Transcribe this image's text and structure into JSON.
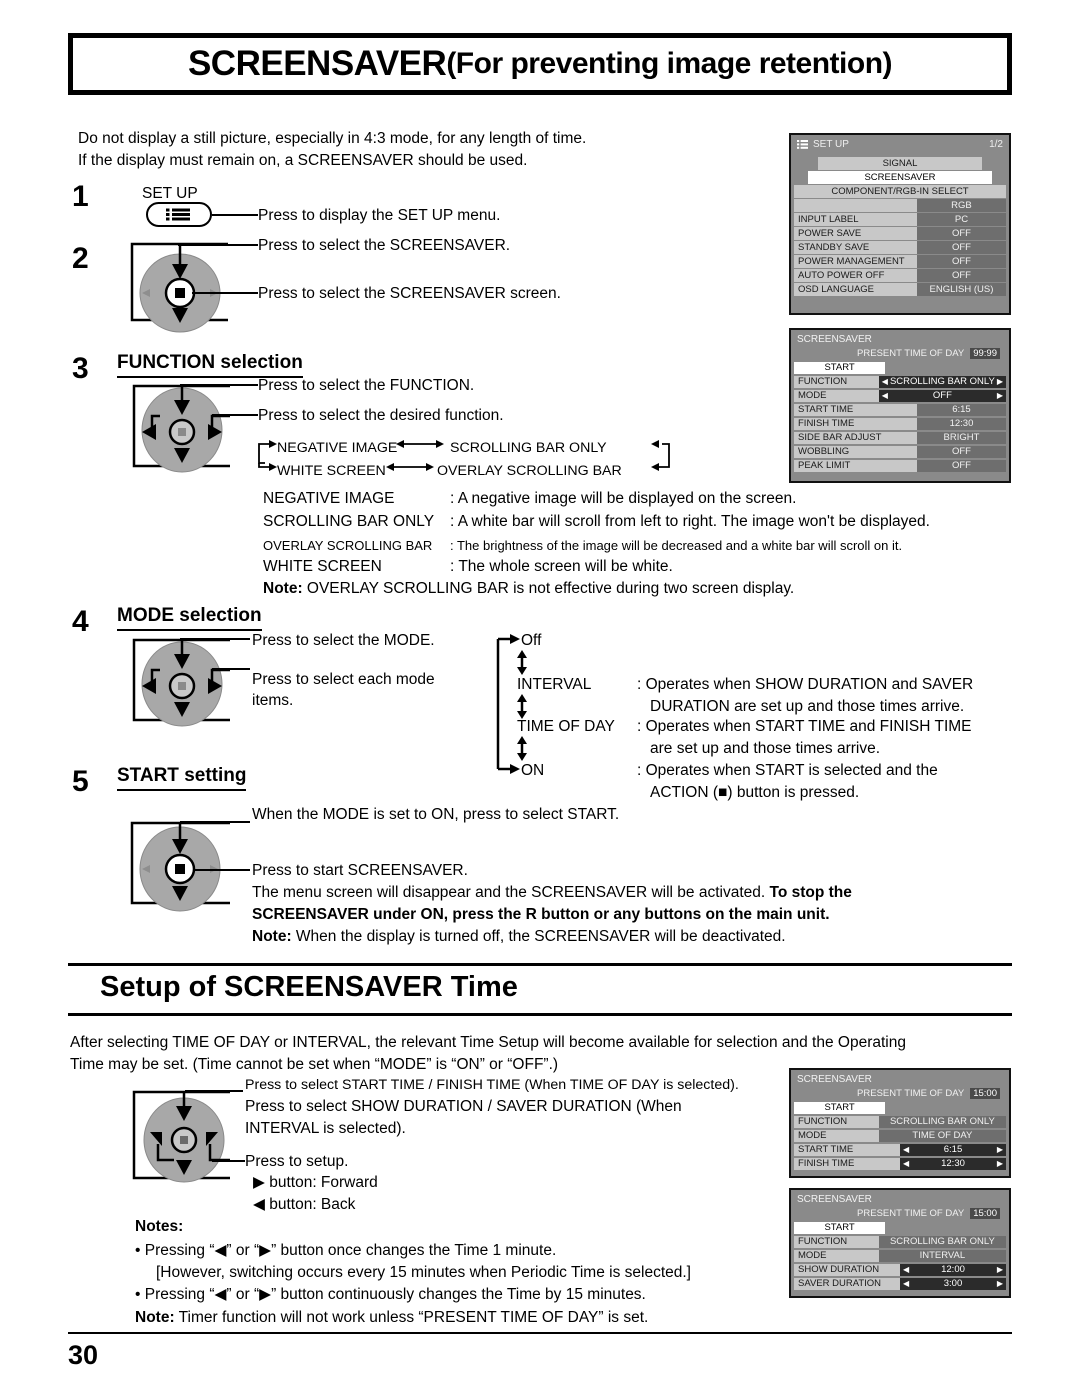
{
  "header": {
    "title_main": "SCREENSAVER",
    "title_sub": " (For preventing image retention)"
  },
  "intro": {
    "line1": "Do not display a still picture, especially in 4:3 mode, for any length of time.",
    "line2": "If the display must remain on, a SCREENSAVER should be used."
  },
  "steps": {
    "one": {
      "num": "1",
      "button_label": "SET UP",
      "instruction": "Press to display the SET UP menu."
    },
    "two": {
      "num": "2",
      "instruction_up": "Press to select the SCREENSAVER.",
      "instruction_action": "Press to select the SCREENSAVER screen."
    },
    "three": {
      "num": "3",
      "heading": "FUNCTION selection",
      "instruction_up": "Press to select the FUNCTION.",
      "instruction_lr": "Press to select the desired function.",
      "cycle": {
        "row1_a": "NEGATIVE IMAGE",
        "row1_b": "SCROLLING BAR ONLY",
        "row2_a": "WHITE SCREEN",
        "row2_b": "OVERLAY SCROLLING BAR"
      },
      "descriptions": [
        {
          "term": "NEGATIVE IMAGE",
          "desc": ": A negative image will be displayed on the screen."
        },
        {
          "term": "SCROLLING BAR ONLY",
          "desc": ": A white bar will scroll from left to right. The image won't be displayed."
        },
        {
          "term": "OVERLAY SCROLLING BAR",
          "desc": ": The brightness of the image will be decreased and a white bar will scroll on it."
        },
        {
          "term": "WHITE SCREEN",
          "desc": ": The whole screen will be white."
        }
      ],
      "note_label": "Note:",
      "note_text": " OVERLAY SCROLLING BAR is not effective during two screen display."
    },
    "four": {
      "num": "4",
      "heading": "MODE selection",
      "instruction_up": "Press to select the MODE.",
      "instruction_lr_l1": "Press to select each mode",
      "instruction_lr_l2": "items.",
      "modes": [
        {
          "name": "Off",
          "desc_l1": "",
          "desc_l2": ""
        },
        {
          "name": "INTERVAL",
          "desc_l1": ": Operates when SHOW DURATION and SAVER",
          "desc_l2": "DURATION are set up and those times arrive."
        },
        {
          "name": "TIME OF DAY",
          "desc_l1": ": Operates when START TIME and FINISH TIME",
          "desc_l2": "are set up and those times arrive."
        },
        {
          "name": "ON",
          "desc_l1": ": Operates  when  START  is  selected  and  the",
          "desc_l2": "ACTION (■) button is pressed."
        }
      ]
    },
    "five": {
      "num": "5",
      "heading": "START setting",
      "instruction_up": "When the MODE is set to ON, press to select START.",
      "instruction_action": "Press to start SCREENSAVER.",
      "body_l1_normal": "The  menu  screen  will  disappear  and  the  SCREENSAVER  will  be  activated.  ",
      "body_l1_bold": "To stop the",
      "body_l2_bold": "SCREENSAVER under ON, press the R button or any buttons on the main unit.",
      "note_label": "Note:",
      "note_text": " When the display is turned off, the SCREENSAVER will be deactivated."
    }
  },
  "section2": {
    "title": "Setup of SCREENSAVER Time",
    "intro_l1": "After selecting TIME OF DAY or INTERVAL, the relevant Time Setup will become available for selection and the Operating",
    "intro_l2": "Time may be set. (Time cannot be set when “MODE” is “ON” or “OFF”.)",
    "instruction_up_l1": "Press to select START TIME / FINISH TIME (When TIME OF DAY is selected).",
    "instruction_up_l2": "Press to select SHOW DURATION / SAVER DURATION (When",
    "instruction_up_l3": "INTERVAL is selected).",
    "instruction_lr": "Press to setup.",
    "forward": "▶ button: Forward",
    "back": "◀ button: Back",
    "notes_label": "Notes:",
    "note1": "• Pressing “◀” or “▶” button once changes the Time 1 minute.",
    "note1b": "[However, switching occurs every 15 minutes when Periodic Time is selected.]",
    "note2": "• Pressing “◀” or “▶” button continuously changes the Time by 15 minutes.",
    "final_note_label": "Note:",
    "final_note_text": " Timer function will not work unless “PRESENT TIME OF DAY” is set."
  },
  "osd": {
    "setup_menu": {
      "title": "SET UP",
      "page": "1/2",
      "icon": "menu-list-icon",
      "rows": [
        {
          "type": "full",
          "label": "SIGNAL",
          "style": "gray"
        },
        {
          "type": "full",
          "label": "SCREENSAVER",
          "style": "white"
        },
        {
          "type": "full-left",
          "label": "COMPONENT/RGB-IN SELECT",
          "style": "gray"
        },
        {
          "type": "value-only",
          "label": "",
          "value": "RGB"
        },
        {
          "type": "pair",
          "label": "INPUT LABEL",
          "value": "PC"
        },
        {
          "type": "pair",
          "label": "POWER SAVE",
          "value": "OFF"
        },
        {
          "type": "pair",
          "label": "STANDBY SAVE",
          "value": "OFF"
        },
        {
          "type": "pair",
          "label": "POWER MANAGEMENT",
          "value": "OFF"
        },
        {
          "type": "pair",
          "label": "AUTO POWER OFF",
          "value": "OFF"
        },
        {
          "type": "pair",
          "label": "OSD LANGUAGE",
          "value": "ENGLISH (US)"
        }
      ]
    },
    "screensaver_menu": {
      "title": "SCREENSAVER",
      "present_label": "PRESENT  TIME OF DAY",
      "present_time": "99:99",
      "start_label": "START",
      "rows": [
        {
          "type": "adjust",
          "label": "FUNCTION",
          "value": "SCROLLING BAR ONLY"
        },
        {
          "type": "adjust",
          "label": "MODE",
          "value": "OFF"
        },
        {
          "type": "pair",
          "label": "START TIME",
          "value": "6:15"
        },
        {
          "type": "pair",
          "label": "FINISH TIME",
          "value": "12:30"
        },
        {
          "type": "pair",
          "label": "SIDE BAR ADJUST",
          "value": "BRIGHT"
        },
        {
          "type": "pair",
          "label": "WOBBLING",
          "value": "OFF"
        },
        {
          "type": "pair",
          "label": "PEAK LIMIT",
          "value": "OFF"
        }
      ]
    },
    "timeofday_menu": {
      "title": "SCREENSAVER",
      "present_label": "PRESENT  TIME OF DAY",
      "present_time": "15:00",
      "start_label": "START",
      "rows": [
        {
          "type": "pair",
          "label": "FUNCTION",
          "value": "SCROLLING BAR ONLY"
        },
        {
          "type": "pair",
          "label": "MODE",
          "value": "TIME OF DAY"
        },
        {
          "type": "adjust",
          "label": "START TIME",
          "value": "6:15"
        },
        {
          "type": "adjust",
          "label": "FINISH TIME",
          "value": "12:30"
        }
      ]
    },
    "interval_menu": {
      "title": "SCREENSAVER",
      "present_label": "PRESENT  TIME OF DAY",
      "present_time": "15:00",
      "start_label": "START",
      "rows": [
        {
          "type": "pair",
          "label": "FUNCTION",
          "value": "SCROLLING BAR ONLY"
        },
        {
          "type": "pair",
          "label": "MODE",
          "value": "INTERVAL"
        },
        {
          "type": "adjust",
          "label": "SHOW DURATION",
          "value": "12:00"
        },
        {
          "type": "adjust",
          "label": "SAVER DURATION",
          "value": "3:00"
        }
      ]
    }
  },
  "footer": {
    "page_number": "30"
  }
}
